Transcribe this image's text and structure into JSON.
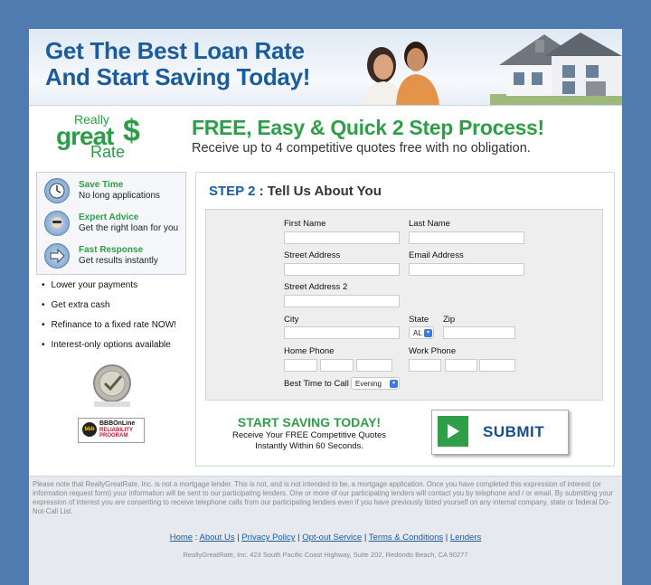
{
  "banner": {
    "line1": "Get The Best Loan Rate",
    "line2": "And Start Saving Today!"
  },
  "logo": {
    "line1": "Really",
    "line2": "great",
    "line3": "Rate",
    "symbol": "$"
  },
  "headline": "FREE, Easy & Quick 2 Step Process!",
  "subhead": "Receive up to 4 competitive quotes free with no obligation.",
  "features": [
    {
      "title": "Save Time",
      "text": "No long applications",
      "icon": "clock-icon"
    },
    {
      "title": "Expert Advice",
      "text": "Get the right loan for you",
      "icon": "advisor-icon"
    },
    {
      "title": "Fast Response",
      "text": "Get results instantly",
      "icon": "arrow-icon"
    }
  ],
  "bullets": [
    "Lower your payments",
    "Get extra cash",
    "Refinance to a fixed rate NOW!",
    "Interest-only options available"
  ],
  "bbb": {
    "brand": "BBBOnLine",
    "sub": "RELIABILITY PROGRAM",
    "mark": "bbb"
  },
  "step": {
    "number": "STEP 2",
    "sep": " : ",
    "title": "Tell Us About You"
  },
  "form": {
    "first_name": "First Name",
    "last_name": "Last Name",
    "street_address": "Street Address",
    "email_address": "Email Address",
    "street_address_2": "Street Address 2",
    "city": "City",
    "state": "State",
    "state_value": "AL",
    "zip": "Zip",
    "home_phone": "Home Phone",
    "work_phone": "Work Phone",
    "best_time": "Best Time to Call",
    "best_time_value": "Evening"
  },
  "cta": {
    "title": "START SAVING TODAY!",
    "line1": "Receive Your FREE Competitive Quotes",
    "line2": "Instantly Within 60 Seconds."
  },
  "submit_label": "SUBMIT",
  "disclaimer": "Please note that ReallyGreatRate, Inc. is not a mortgage lender. This is not, and is not intended to be, a mortgage application. Once you have completed this expression of interest (or information request form) your information will be sent to our participating lenders. One or more of our participating lenders will contact you by telephone and / or email. By submitting your expression of interest you are consenting to receive telephone calls from our participating lenders even if you have previously listed yourself on any internal company, state or federal Do-Not-Call List.",
  "footer": {
    "links": [
      "Home",
      "About Us",
      "Privacy Policy",
      "Opt-out Service",
      "Terms & Conditions",
      "Lenders"
    ],
    "address": "ReallyGreatRate, Inc. 423 South Pacific Coast Highway, Suite 202, Redondo Beach, CA 90277"
  },
  "colors": {
    "brand_green": "#2e9e48",
    "brand_blue": "#1b5c9e",
    "page_bg": "#4f7bb0"
  }
}
